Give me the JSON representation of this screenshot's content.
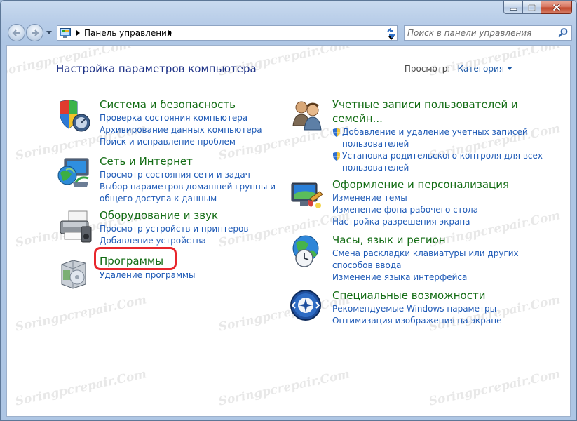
{
  "window": {
    "colors": {
      "accent_link": "#1d59b6",
      "category_title": "#136c14",
      "page_title": "#1e3287",
      "highlight": "#e8262c"
    }
  },
  "address_bar": {
    "path": "Панель управления"
  },
  "search": {
    "placeholder": "Поиск в панели управления"
  },
  "header": {
    "title": "Настройка параметров компьютера",
    "view_label": "Просмотр:",
    "view_value": "Категория"
  },
  "categories": [
    {
      "title": "Система и безопасность",
      "icon": "shield-computer-icon",
      "links": [
        "Проверка состояния компьютера",
        "Архивирование данных компьютера",
        "Поиск и исправление проблем"
      ]
    },
    {
      "title": "Сеть и Интернет",
      "icon": "network-globe-icon",
      "links": [
        "Просмотр состояния сети и задач",
        "Выбор параметров домашней группы и",
        "общего доступа к данным"
      ]
    },
    {
      "title": "Оборудование и звук",
      "icon": "printer-hardware-icon",
      "links": [
        "Просмотр устройств и принтеров",
        "Добавление устройства"
      ]
    },
    {
      "title": "Программы",
      "icon": "programs-box-icon",
      "links": [
        "Удаление программы"
      ]
    },
    {
      "title_line1": "Учетные записи пользователей и",
      "title_line2": "семейн...",
      "icon": "users-icon",
      "links": [
        "Добавление и удаление учетных записей",
        "пользователей",
        "Установка родительского контроля для всех",
        "пользователей"
      ]
    },
    {
      "title": "Оформление и персонализация",
      "icon": "monitor-paint-icon",
      "links": [
        "Изменение темы",
        "Изменение фона рабочего стола",
        "Настройка разрешения экрана"
      ]
    },
    {
      "title": "Часы, язык и регион",
      "icon": "globe-clock-icon",
      "links": [
        "Смена раскладки клавиатуры или других",
        "способов ввода",
        "Изменение языка интерфейса"
      ]
    },
    {
      "title": "Специальные возможности",
      "icon": "accessibility-icon",
      "links": [
        "Рекомендуемые Windows параметры",
        "Оптимизация изображения на экране"
      ]
    }
  ],
  "watermark": "Soringpcrepair.Com"
}
